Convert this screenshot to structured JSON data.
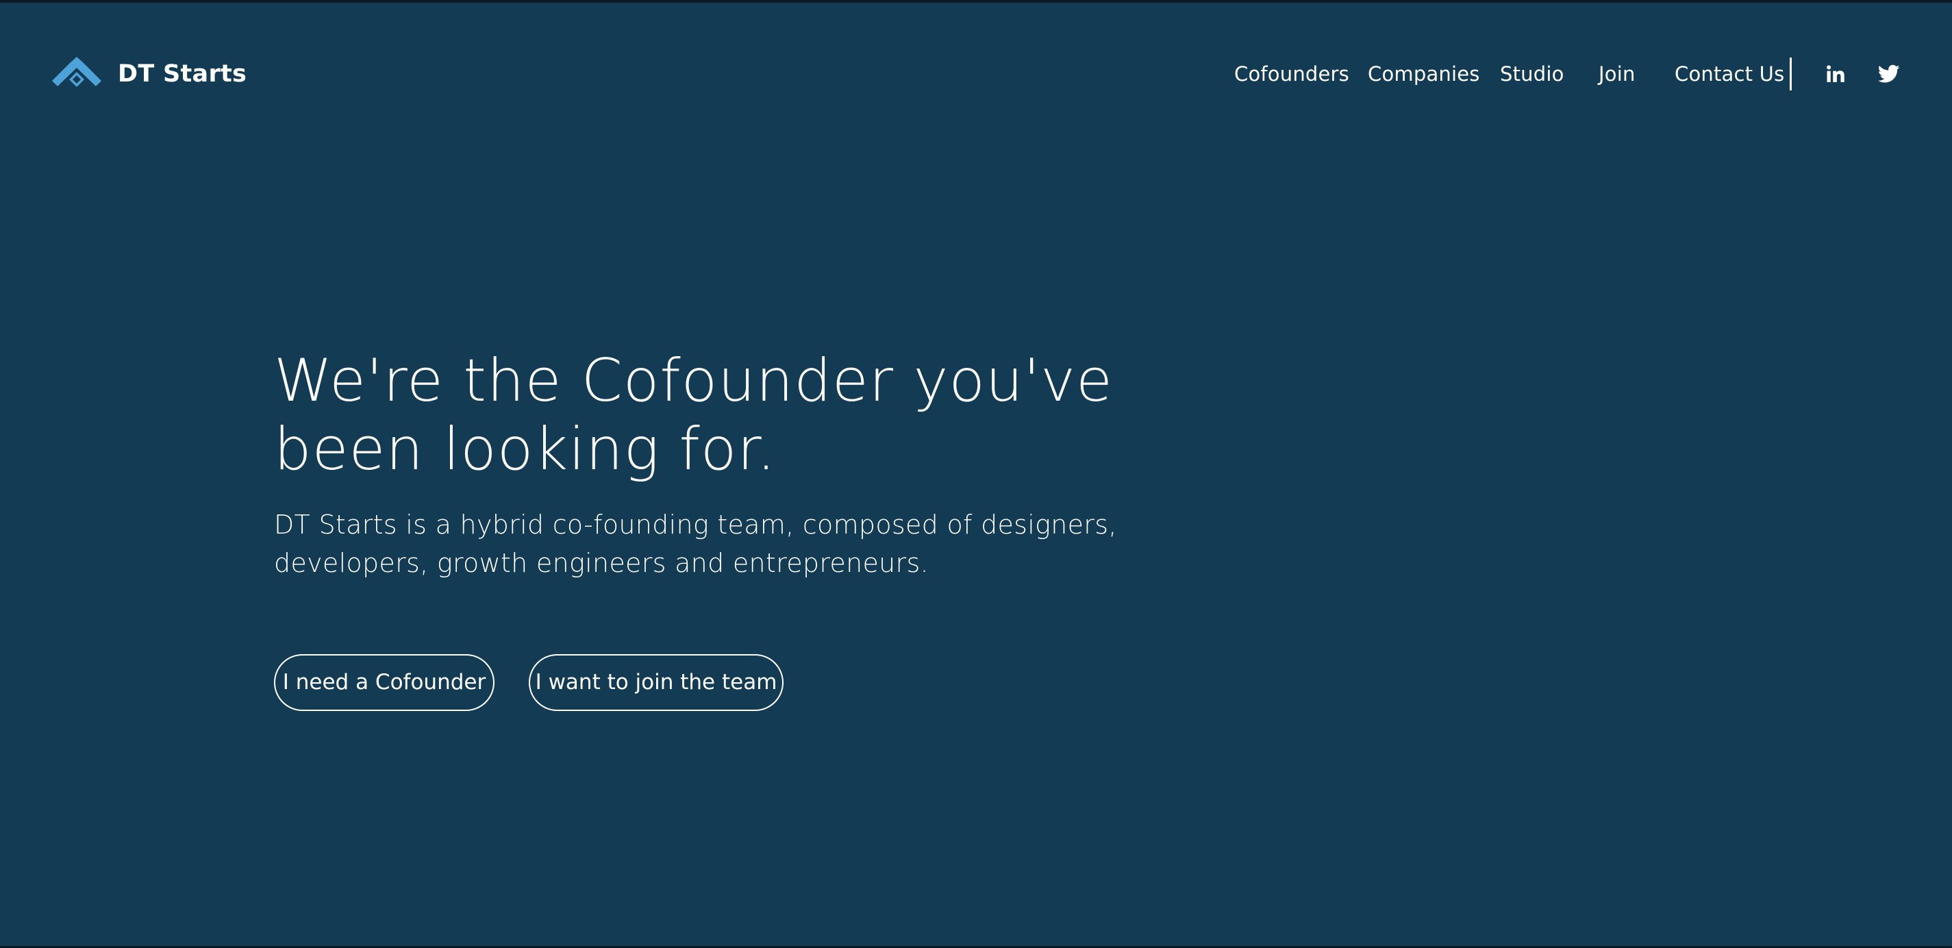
{
  "brand": {
    "name": "DT Starts",
    "logo_icon": "dt-starts-logo-icon",
    "logo_color": "#4da3d8"
  },
  "nav": {
    "items": [
      {
        "label": "Cofounders"
      },
      {
        "label": "Companies"
      },
      {
        "label": "Studio"
      },
      {
        "label": "Join"
      },
      {
        "label": "Contact Us"
      }
    ],
    "social": [
      {
        "icon": "linkedin-icon"
      },
      {
        "icon": "twitter-icon"
      }
    ]
  },
  "hero": {
    "title_line1": "We're the Cofounder you've",
    "title_line2": "been looking for.",
    "subtitle_line1": "DT Starts is a hybrid co-founding team, composed of designers,",
    "subtitle_line2": "developers, growth engineers and entrepreneurs.",
    "buttons": [
      {
        "label": "I need a Cofounder"
      },
      {
        "label": "I want to join the team"
      }
    ]
  },
  "colors": {
    "background": "#133c54",
    "text": "#ffffff",
    "accent": "#4da3d8"
  }
}
